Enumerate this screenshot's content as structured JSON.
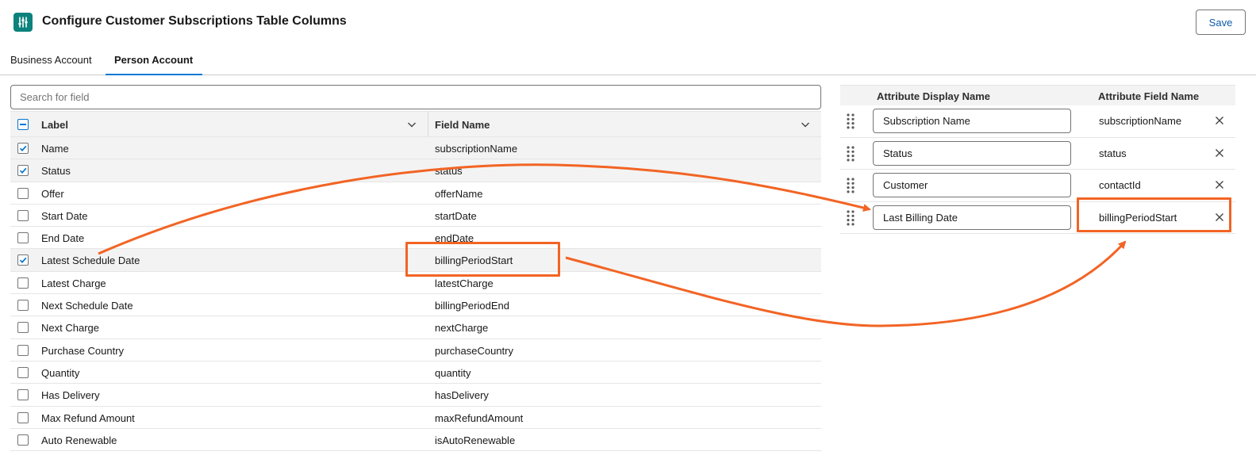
{
  "header": {
    "title": "Configure Customer Subscriptions Table Columns",
    "save_label": "Save",
    "icon": "settings-sliders-icon"
  },
  "tabs": [
    {
      "label": "Business Account",
      "active": false
    },
    {
      "label": "Person Account",
      "active": true
    }
  ],
  "search": {
    "placeholder": "Search for field",
    "value": ""
  },
  "left_table": {
    "columns": [
      "Label",
      "Field Name"
    ],
    "rows": [
      {
        "label": "Name",
        "field": "subscriptionName",
        "checked": true
      },
      {
        "label": "Status",
        "field": "status",
        "checked": true
      },
      {
        "label": "Offer",
        "field": "offerName",
        "checked": false
      },
      {
        "label": "Start Date",
        "field": "startDate",
        "checked": false
      },
      {
        "label": "End Date",
        "field": "endDate",
        "checked": false
      },
      {
        "label": "Latest Schedule Date",
        "field": "billingPeriodStart",
        "checked": true
      },
      {
        "label": "Latest Charge",
        "field": "latestCharge",
        "checked": false
      },
      {
        "label": "Next Schedule Date",
        "field": "billingPeriodEnd",
        "checked": false
      },
      {
        "label": "Next Charge",
        "field": "nextCharge",
        "checked": false
      },
      {
        "label": "Purchase Country",
        "field": "purchaseCountry",
        "checked": false
      },
      {
        "label": "Quantity",
        "field": "quantity",
        "checked": false
      },
      {
        "label": "Has Delivery",
        "field": "hasDelivery",
        "checked": false
      },
      {
        "label": "Max Refund Amount",
        "field": "maxRefundAmount",
        "checked": false
      },
      {
        "label": "Auto Renewable",
        "field": "isAutoRenewable",
        "checked": false
      }
    ]
  },
  "right_table": {
    "columns": [
      "Attribute Display Name",
      "Attribute Field Name"
    ],
    "rows": [
      {
        "display": "Subscription Name",
        "field": "subscriptionName"
      },
      {
        "display": "Status",
        "field": "status"
      },
      {
        "display": "Customer",
        "field": "contactId"
      },
      {
        "display": "Last Billing Date",
        "field": "billingPeriodStart"
      }
    ]
  },
  "colors": {
    "brand_icon": "#0b827c",
    "accent_blue": "#0176d3",
    "annotation_orange": "#f26424"
  }
}
